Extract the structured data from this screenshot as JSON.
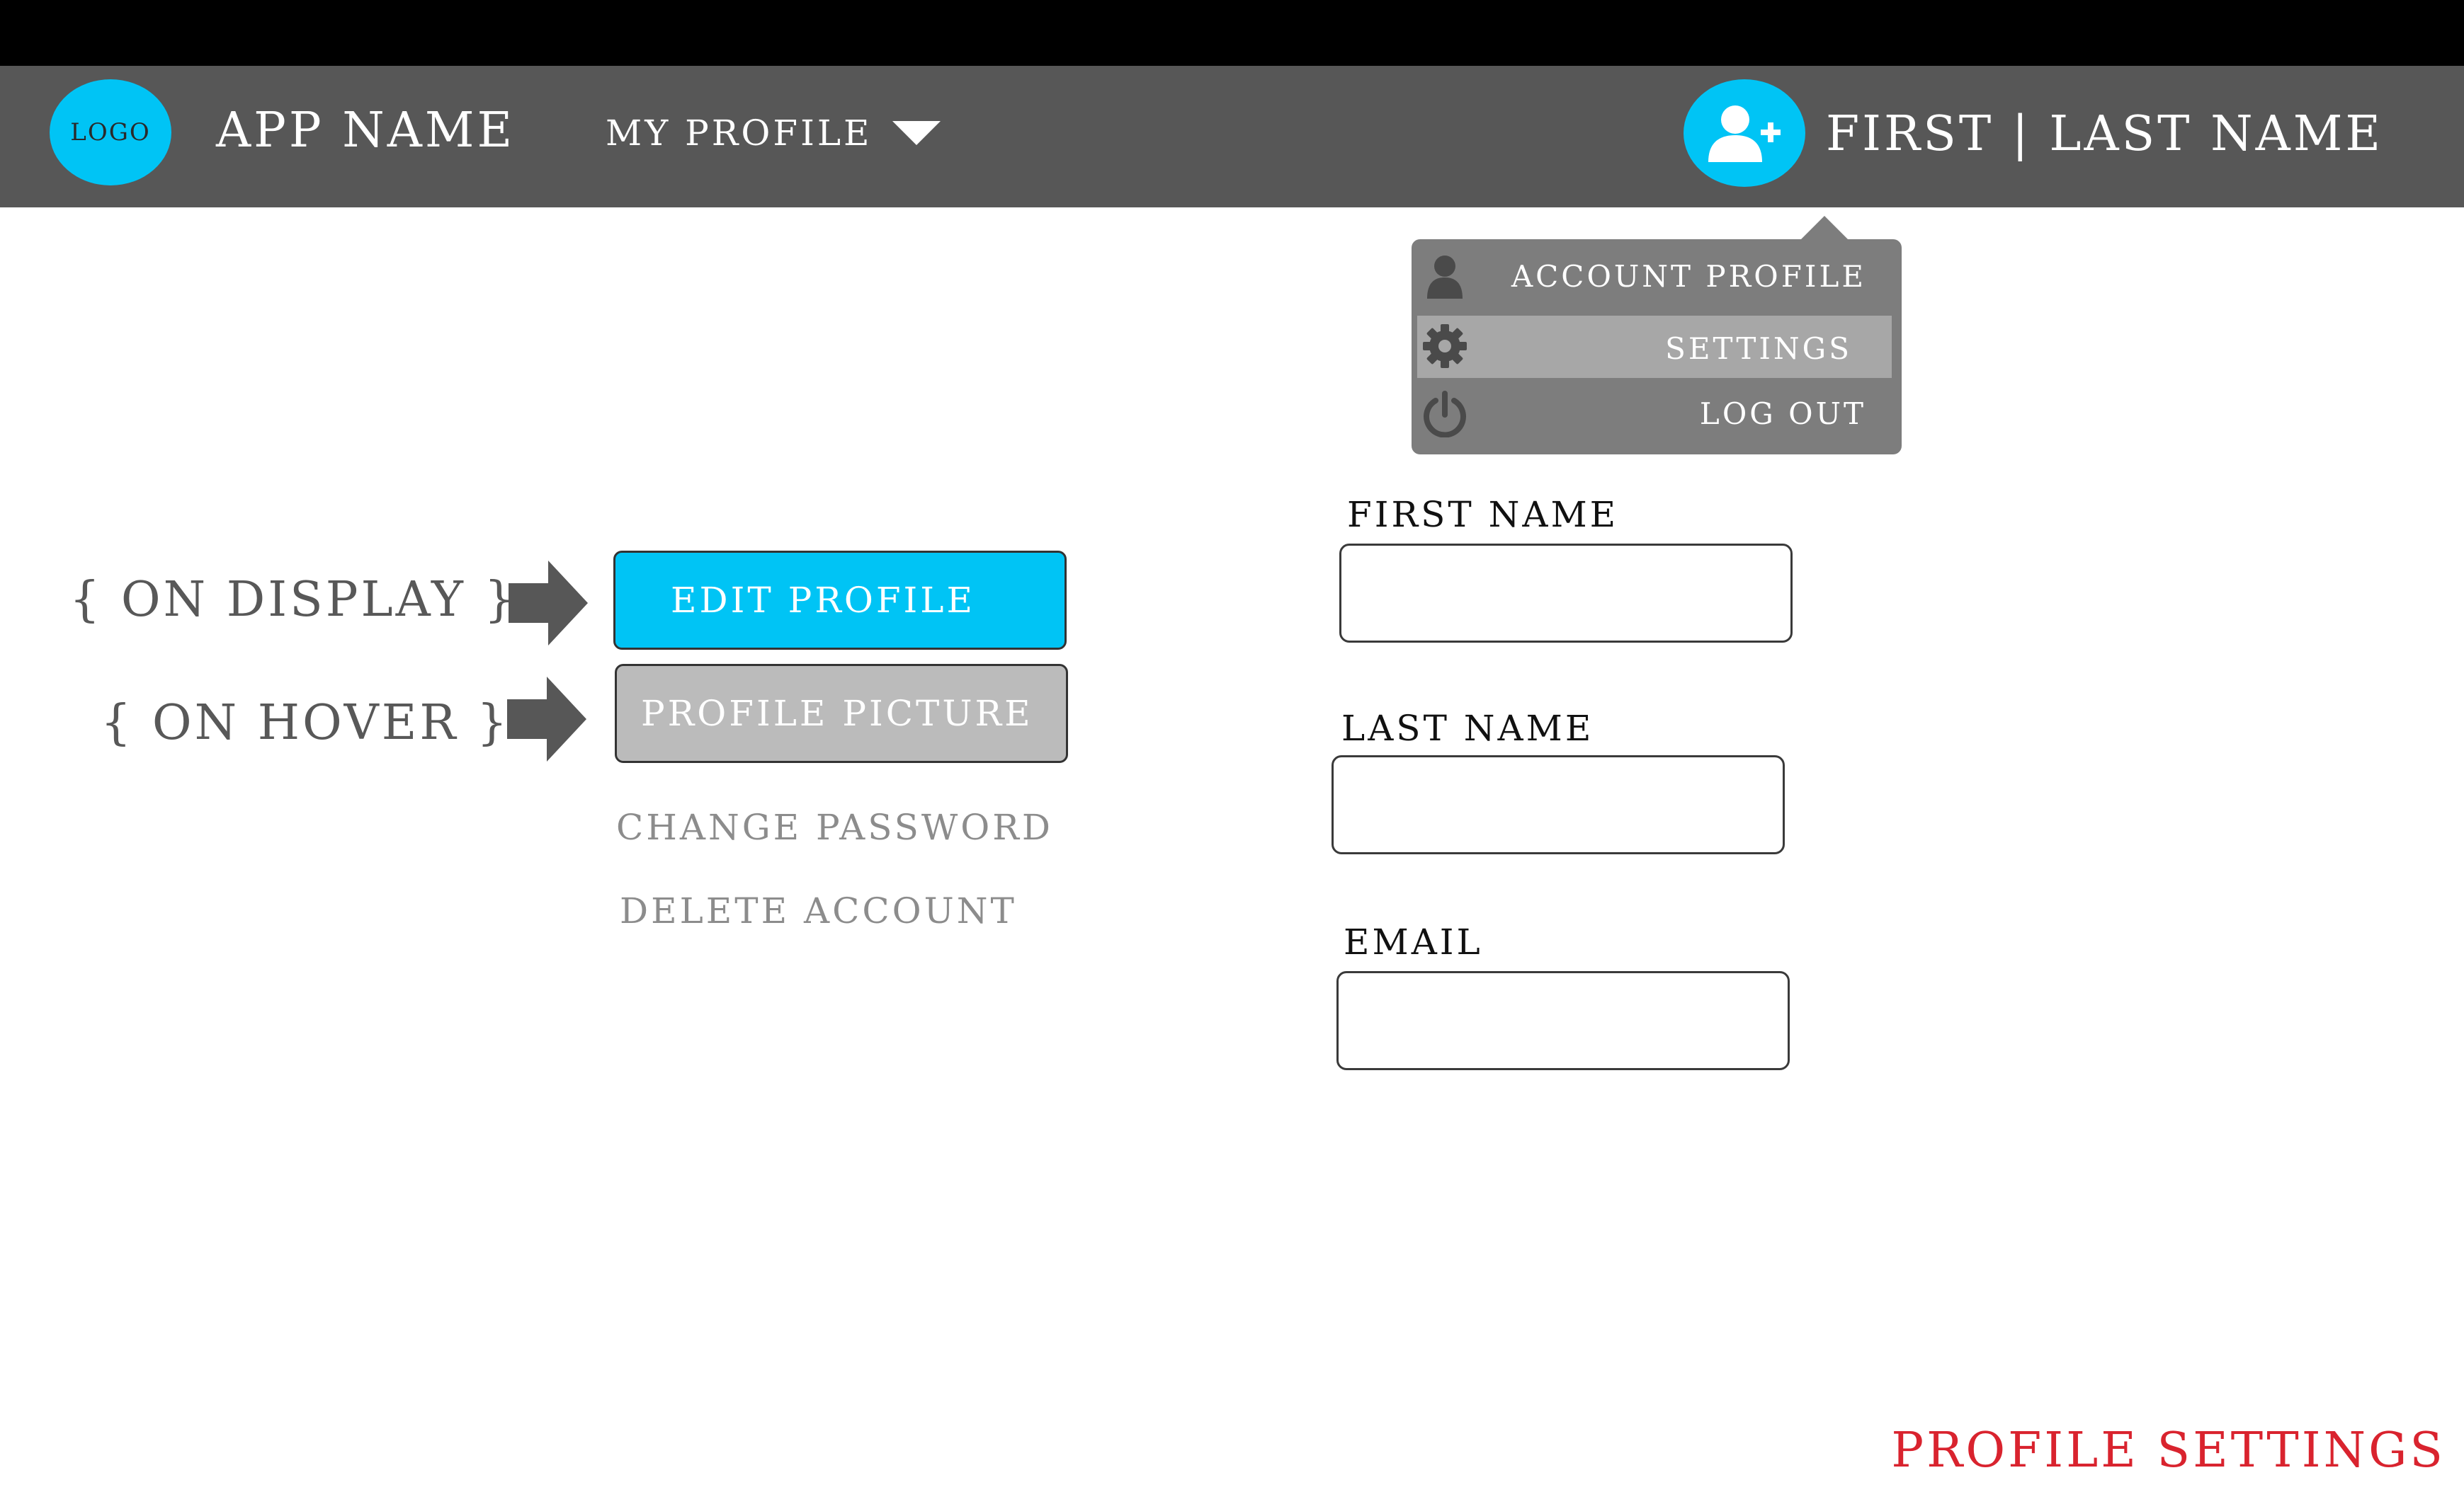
{
  "header": {
    "logo_label": "LOGO",
    "app_name": "APP NAME",
    "nav_label": "MY PROFILE",
    "user_name": "FIRST | LAST NAME"
  },
  "user_menu": {
    "items": [
      {
        "label": "ACCOUNT PROFILE",
        "icon": "user-icon"
      },
      {
        "label": "SETTINGS",
        "icon": "gear-icon",
        "active": true
      },
      {
        "label": "LOG OUT",
        "icon": "power-icon"
      }
    ]
  },
  "annotations": {
    "on_display": "{ ON DISPLAY }",
    "on_hover": "{ ON HOVER }"
  },
  "actions": {
    "edit_profile": "EDIT PROFILE",
    "profile_picture": "PROFILE PICTURE",
    "change_password": "CHANGE PASSWORD",
    "delete_account": "DELETE ACCOUNT"
  },
  "form": {
    "first_name_label": "FIRST NAME",
    "first_name_value": "",
    "last_name_label": "LAST NAME",
    "last_name_value": "",
    "email_label": "EMAIL",
    "email_value": ""
  },
  "page_title": "PROFILE SETTINGS",
  "colors": {
    "accent": "#00c4f5",
    "nav_bg": "#575757",
    "menu_bg": "#7d7d7d",
    "menu_active": "#a7a7a7",
    "title_red": "#d9232e",
    "hover_button": "#bbbbbb"
  }
}
